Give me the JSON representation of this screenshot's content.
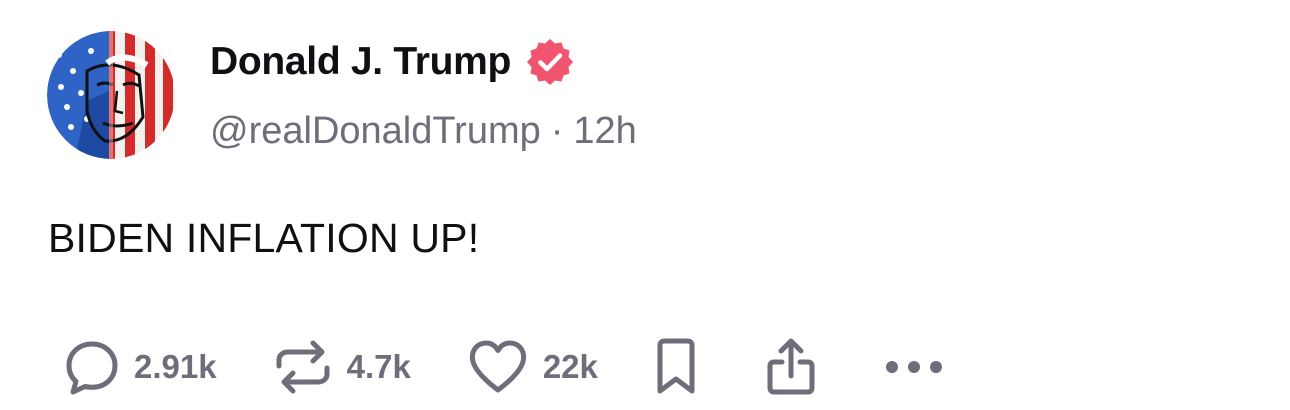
{
  "post": {
    "author": {
      "display_name": "Donald J. Trump",
      "handle": "@realDonaldTrump",
      "verified": true,
      "verified_badge_color": "#f0546e"
    },
    "timestamp": "12h",
    "meta_separator": "·",
    "text": "BIDEN INFLATION UP!",
    "actions": {
      "reply": {
        "icon": "reply-bubble-icon",
        "count": "2.91k"
      },
      "retruth": {
        "icon": "retruth-icon",
        "count": "4.7k"
      },
      "like": {
        "icon": "heart-icon",
        "count": "22k"
      },
      "bookmark": {
        "icon": "bookmark-icon"
      },
      "share": {
        "icon": "share-icon"
      },
      "more": {
        "icon": "more-dots-icon"
      }
    }
  },
  "colors": {
    "text_primary": "#0f0f14",
    "text_secondary": "#6e6e7a",
    "icon_gray": "#6e6e7a",
    "badge_pink": "#f0546e"
  }
}
